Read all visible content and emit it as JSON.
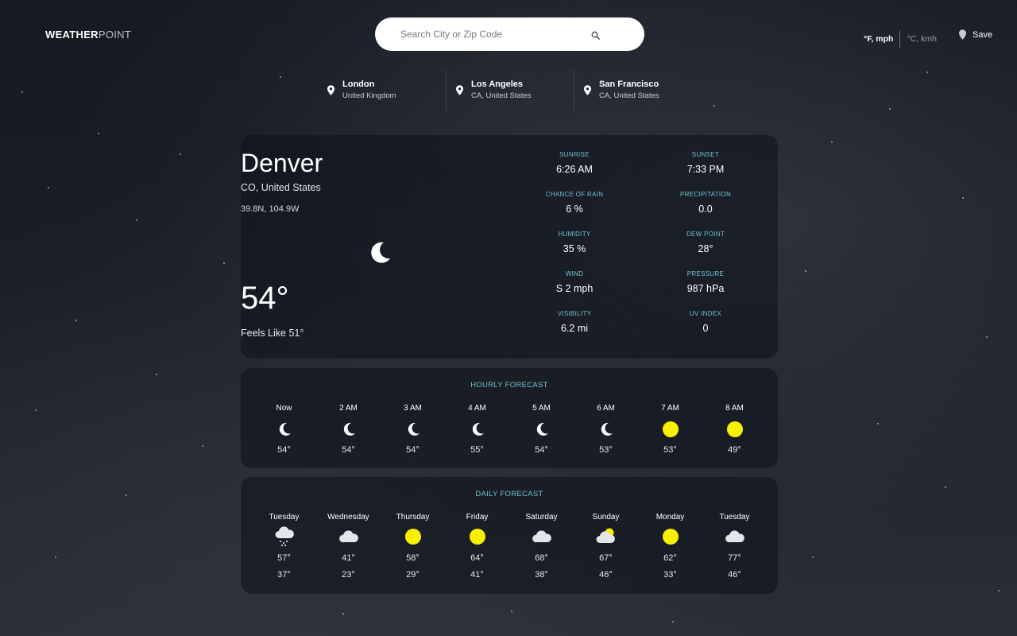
{
  "logo": {
    "bold": "WEATHER",
    "thin": "POINT"
  },
  "search": {
    "placeholder": "Search City or Zip Code"
  },
  "units": {
    "imperial": "°F, mph",
    "metric": "°C, kmh"
  },
  "save_label": "Save",
  "saved_locations": [
    {
      "city": "London",
      "region": "United Kingdom"
    },
    {
      "city": "Los Angeles",
      "region": "CA, United States"
    },
    {
      "city": "San Francisco",
      "region": "CA, United States"
    }
  ],
  "current": {
    "city": "Denver",
    "region": "CO, United States",
    "coords": "39.8N, 104.9W",
    "icon": "moon-icon",
    "temp": "54°",
    "feels_like": "Feels Like 51°"
  },
  "stats": [
    {
      "label": "Sunrise",
      "value": "6:26 AM"
    },
    {
      "label": "Sunset",
      "value": "7:33 PM"
    },
    {
      "label": "Chance of Rain",
      "value": "6 %"
    },
    {
      "label": "Precipitation",
      "value": "0.0"
    },
    {
      "label": "Humidity",
      "value": "35 %"
    },
    {
      "label": "Dew Point",
      "value": "28°"
    },
    {
      "label": "Wind",
      "value": "S 2 mph"
    },
    {
      "label": "Pressure",
      "value": "987 hPa"
    },
    {
      "label": "Visibility",
      "value": "6.2 mi"
    },
    {
      "label": "UV Index",
      "value": "0"
    }
  ],
  "hourly": {
    "title": "Hourly Forecast",
    "items": [
      {
        "time": "Now",
        "icon": "moon-icon",
        "temp": "54°"
      },
      {
        "time": "2 AM",
        "icon": "moon-icon",
        "temp": "54°"
      },
      {
        "time": "3 AM",
        "icon": "moon-icon",
        "temp": "54°"
      },
      {
        "time": "4 AM",
        "icon": "moon-icon",
        "temp": "55°"
      },
      {
        "time": "5 AM",
        "icon": "moon-icon",
        "temp": "54°"
      },
      {
        "time": "6 AM",
        "icon": "moon-icon",
        "temp": "53°"
      },
      {
        "time": "7 AM",
        "icon": "sun-icon",
        "temp": "53°"
      },
      {
        "time": "8 AM",
        "icon": "sun-icon",
        "temp": "49°"
      }
    ]
  },
  "daily": {
    "title": "Daily Forecast",
    "items": [
      {
        "day": "Tuesday",
        "icon": "snow-cloud-icon",
        "hi": "57°",
        "lo": "37°"
      },
      {
        "day": "Wednesday",
        "icon": "cloud-icon",
        "hi": "41°",
        "lo": "23°"
      },
      {
        "day": "Thursday",
        "icon": "sun-icon",
        "hi": "58°",
        "lo": "29°"
      },
      {
        "day": "Friday",
        "icon": "sun-icon",
        "hi": "64°",
        "lo": "41°"
      },
      {
        "day": "Saturday",
        "icon": "cloud-icon",
        "hi": "68°",
        "lo": "38°"
      },
      {
        "day": "Sunday",
        "icon": "partly-cloudy-icon",
        "hi": "67°",
        "lo": "46°"
      },
      {
        "day": "Monday",
        "icon": "sun-icon",
        "hi": "62°",
        "lo": "33°"
      },
      {
        "day": "Tuesday",
        "icon": "cloud-icon",
        "hi": "77°",
        "lo": "46°"
      }
    ]
  },
  "colors": {
    "accent": "#6ec3cc",
    "sun": "#f7f000"
  }
}
